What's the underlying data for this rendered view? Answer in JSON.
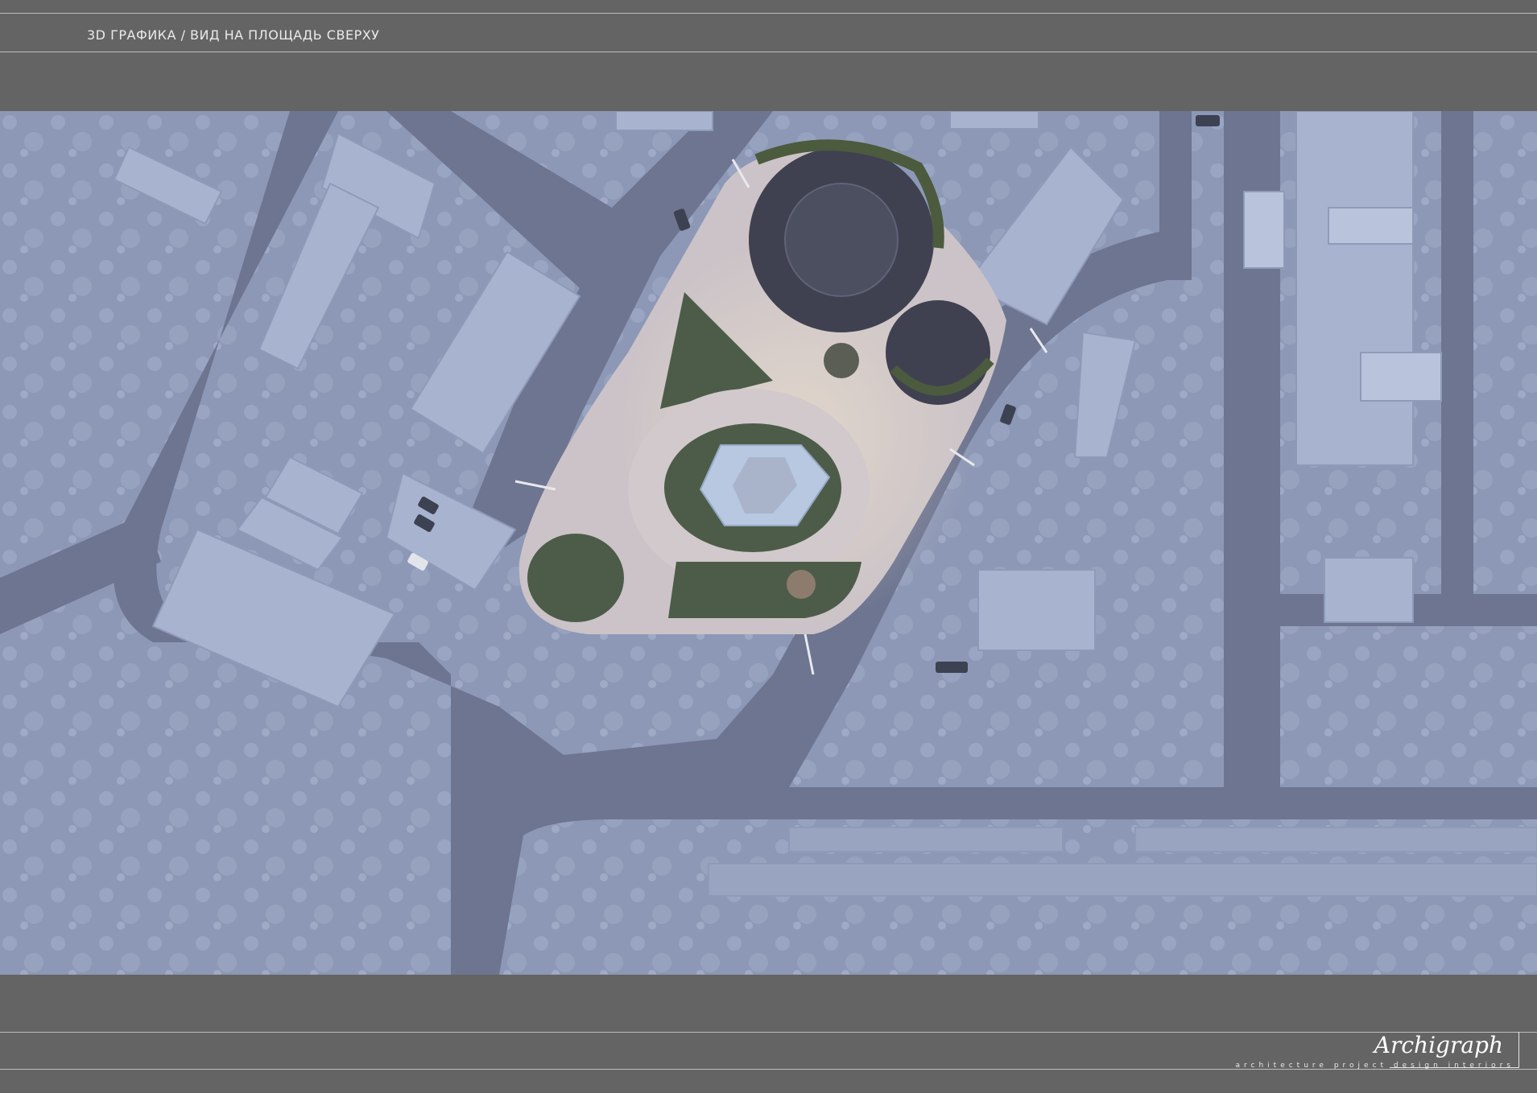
{
  "header": {
    "title": "3D ГРАФИКА / ВИД НА ПЛОЩАДЬ СВЕРХУ"
  },
  "render": {
    "description_icon": "aerial-render-image"
  },
  "logo": {
    "script": "Archigraph",
    "tagline": "architecture project design interiors"
  },
  "colors": {
    "frame": "#646464",
    "rule": "#bdbdbd",
    "ground": "#8a95b3",
    "road": "#6e7690",
    "building": "#a9b4cf",
    "paving": "#c9c4c8",
    "greenery": "#4b5a48"
  }
}
